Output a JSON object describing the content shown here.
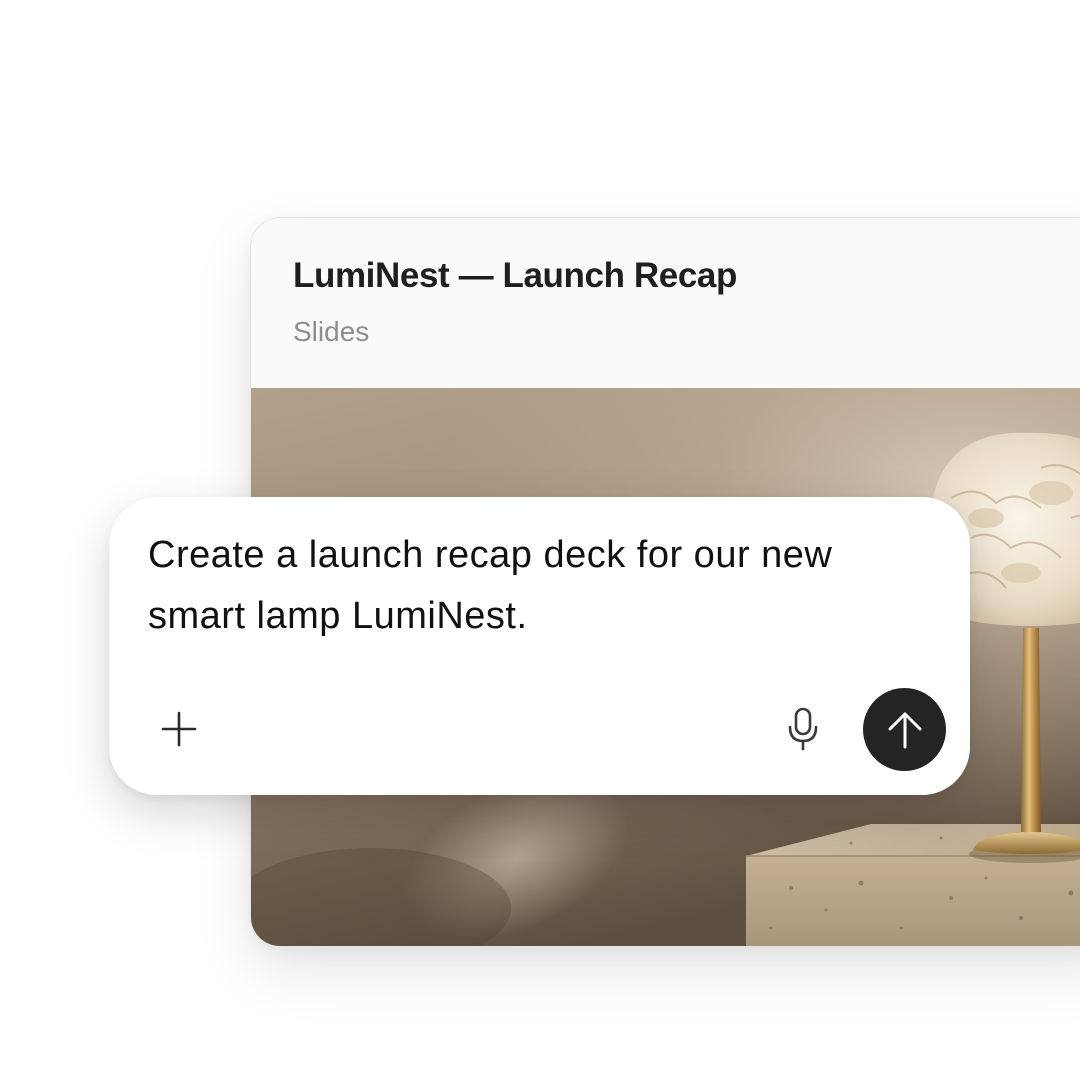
{
  "document": {
    "title": "LumiNest — Launch Recap",
    "type_label": "Slides",
    "preview": {
      "subject": "alabaster table lamp with brass stem on travertine block",
      "colors": {
        "wall_light": "#b8a58e",
        "wall_dark": "#6b5a48",
        "shade": "#ece3d2",
        "brass": "#c9a25e",
        "stone": "#c7b59b"
      }
    }
  },
  "composer": {
    "prompt_text": "Create a launch recap deck for our new smart lamp LumiNest.",
    "add_icon": "plus-icon",
    "mic_icon": "microphone-icon",
    "send_icon": "arrow-up-icon",
    "send_button_color": "#242424"
  }
}
